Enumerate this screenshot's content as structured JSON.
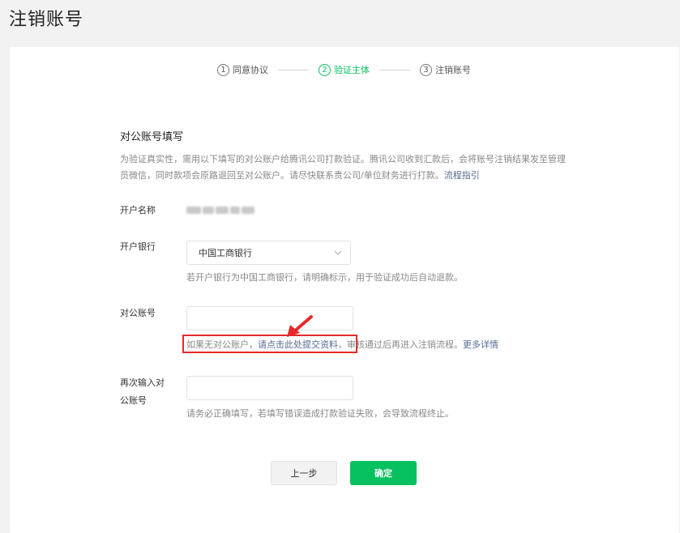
{
  "page": {
    "title": "注销账号"
  },
  "steps": [
    {
      "num": "1",
      "label": "同意协议"
    },
    {
      "num": "2",
      "label": "验证主体"
    },
    {
      "num": "3",
      "label": "注销账号"
    }
  ],
  "active_step": 2,
  "form": {
    "section_title": "对公账号填写",
    "description": "为验证真实性，需用以下填写的对公账户给腾讯公司打款验证。腾讯公司收到汇款后，会将账号注销结果发至管理员微信，同时款项会原路退回至对公账户。请尽快联系贵公司/单位财务进行打款。",
    "description_link": "流程指引",
    "account_name_label": "开户名称",
    "bank_label": "开户银行",
    "bank_value": "中国工商银行",
    "bank_hint": "若开户银行为中国工商银行，请明确标示，用于验证成功后自动退款。",
    "account_label": "对公账号",
    "account_value": "",
    "notice_text": "如果无对公账户，",
    "notice_link": "请点击此处提交资料",
    "notice_after": "，审核通过后再进入注销流程。",
    "notice_more": "更多详情",
    "confirm_label_line1": "再次输入对",
    "confirm_label_line2": "公账号",
    "confirm_value": "",
    "confirm_hint": "请务必正确填写，若填写错误造成打款验证失败，会导致流程终止。"
  },
  "buttons": {
    "prev": "上一步",
    "ok": "确定"
  },
  "colors": {
    "accent": "#07c160",
    "link": "#576b95",
    "highlight": "#e52a2a"
  }
}
